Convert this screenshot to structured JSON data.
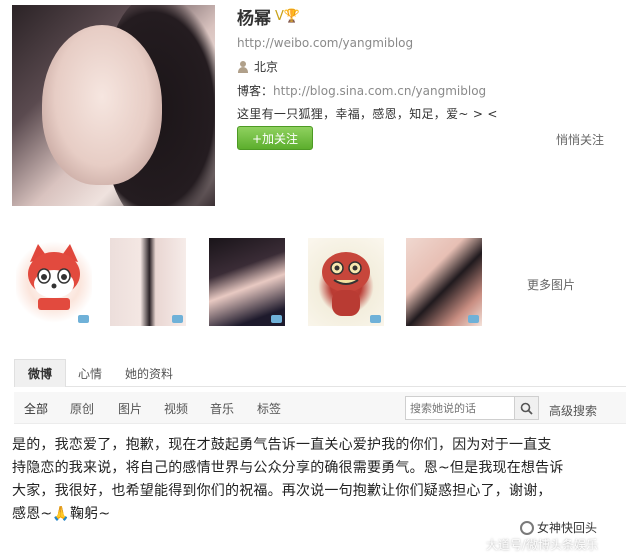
{
  "profile": {
    "name": "杨幂",
    "badges": "V🏆",
    "weibo_url": "http://weibo.com/yangmiblog",
    "location": "北京",
    "blog_label": "博客：",
    "blog_url": "http://blog.sina.com.cn/yangmiblog",
    "bio": "这里有一只狐狸，幸福，感恩，知足，爱~ > <",
    "follow_button": "+加关注",
    "quiet_follow": "悄悄关注"
  },
  "photos": {
    "more_label": "更多图片"
  },
  "tabs": [
    {
      "label": "微博",
      "active": true
    },
    {
      "label": "心情",
      "active": false
    },
    {
      "label": "她的资料",
      "active": false
    }
  ],
  "filters": [
    {
      "label": "全部",
      "active": true
    },
    {
      "label": "原创",
      "active": false
    },
    {
      "label": "图片",
      "active": false
    },
    {
      "label": "视频",
      "active": false
    },
    {
      "label": "音乐",
      "active": false
    },
    {
      "label": "标签",
      "active": false
    }
  ],
  "search": {
    "placeholder": "搜索她说的话",
    "advanced_label": "高级搜索"
  },
  "post": {
    "lines": [
      "是的，我恋爱了，抱歉，现在才鼓起勇气告诉一直关心爱护我的你们，因为对于一直支",
      "持隐恋的我来说，将自己的感情世界与公众分享的确很需要勇气。恩~但是我现在想告诉",
      "大家，我很好，也希望能得到你们的祝福。再次说一句抱歉让你们疑惑担心了，谢谢，",
      "感恩~🙏鞠躬~"
    ]
  },
  "watermark": {
    "line1": "女神快回头",
    "line2": "大道号/微博头条娱乐"
  },
  "colors": {
    "follow_green": "#5cae2d",
    "link_gray": "#8a8a8a",
    "badge_gold": "#c9a21a"
  }
}
